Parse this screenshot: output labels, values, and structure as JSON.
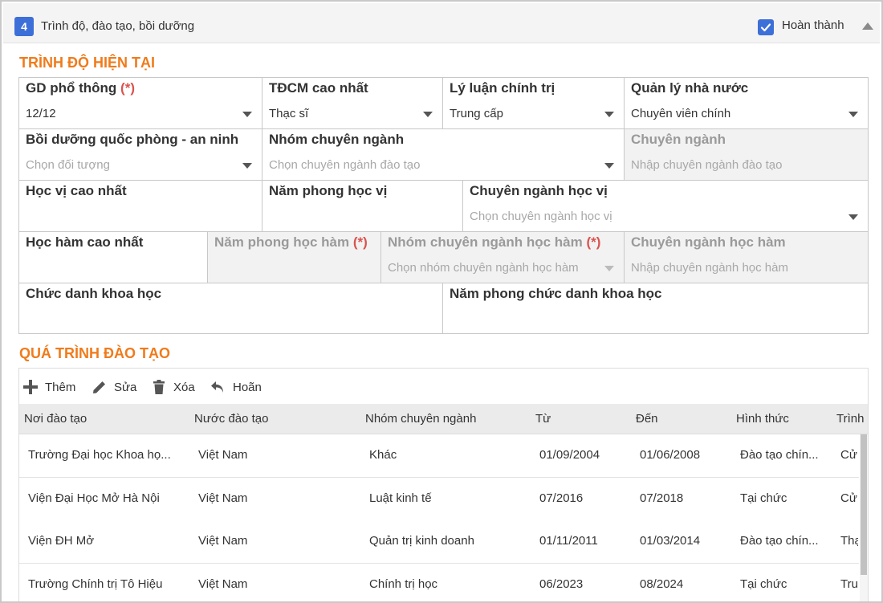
{
  "panel": {
    "step_number": "4",
    "title": "Trình độ, đào tạo, bồi dưỡng",
    "done_label": "Hoàn thành",
    "done_checked": true
  },
  "current_level": {
    "section_title": "TRÌNH ĐỘ HIỆN TẠI",
    "fields": {
      "gd_pho_thong": {
        "label": "GD phổ thông",
        "required": "(*)",
        "value": "12/12"
      },
      "tdcm": {
        "label": "TĐCM cao nhất",
        "value": "Thạc sĩ"
      },
      "ly_luan": {
        "label": "Lý luận chính trị",
        "value": "Trung cấp"
      },
      "quan_ly": {
        "label": "Quản lý nhà nước",
        "value": "Chuyên viên chính"
      },
      "quoc_phong": {
        "label": "Bồi dưỡng quốc phòng - an ninh",
        "placeholder": "Chọn đối tượng"
      },
      "nhom_chuyen_nganh": {
        "label": "Nhóm chuyên ngành",
        "placeholder": "Chọn chuyên ngành đào tạo"
      },
      "chuyen_nganh": {
        "label": "Chuyên ngành",
        "placeholder": "Nhập chuyên ngành đào tạo"
      },
      "hoc_vi": {
        "label": "Học vị cao nhất"
      },
      "nam_phong_hoc_vi": {
        "label": "Năm phong học vị"
      },
      "chuyen_nganh_hoc_vi": {
        "label": "Chuyên ngành học vị",
        "placeholder": "Chọn chuyên ngành học vị"
      },
      "hoc_ham": {
        "label": "Học hàm cao nhất"
      },
      "nam_phong_hoc_ham": {
        "label": "Năm phong học hàm",
        "required": "(*)"
      },
      "nhom_cn_hoc_ham": {
        "label": "Nhóm chuyên ngành học hàm",
        "required": "(*)",
        "placeholder": "Chọn nhóm chuyên ngành học hàm"
      },
      "cn_hoc_ham": {
        "label": "Chuyên ngành học hàm",
        "placeholder": "Nhập chuyên ngành học hàm"
      },
      "chuc_danh": {
        "label": "Chức danh khoa học"
      },
      "nam_chuc_danh": {
        "label": "Năm phong chức danh khoa học"
      }
    }
  },
  "training": {
    "section_title": "QUÁ TRÌNH ĐÀO TẠO",
    "toolbar": {
      "add": "Thêm",
      "edit": "Sửa",
      "delete": "Xóa",
      "undo": "Hoãn"
    },
    "columns": [
      "Nơi đào tạo",
      "Nước đào tạo",
      "Nhóm chuyên ngành",
      "Từ",
      "Đến",
      "Hình thức",
      "Trình"
    ],
    "rows": [
      [
        "Trường Đại học Khoa họ...",
        "Việt Nam",
        "Khác",
        "01/09/2004",
        "01/06/2008",
        "Đào tạo chín...",
        "Cử"
      ],
      [
        "Viện Đại Học Mở Hà Nội",
        "Việt Nam",
        "Luật kinh tế",
        "07/2016",
        "07/2018",
        "Tại chức",
        "Cử"
      ],
      [
        "Viện ĐH Mở",
        "Việt Nam",
        "Quản trị kinh doanh",
        "01/11/2011",
        "01/03/2014",
        "Đào tạo chín...",
        "Thạ"
      ],
      [
        "Trường Chính trị Tô Hiệu",
        "Việt Nam",
        "Chính trị học",
        "06/2023",
        "08/2024",
        "Tại chức",
        "Tru"
      ]
    ]
  },
  "colors": {
    "accent": "#3d6fd8",
    "section_title": "#f07b1b",
    "required": "#d9534f"
  }
}
